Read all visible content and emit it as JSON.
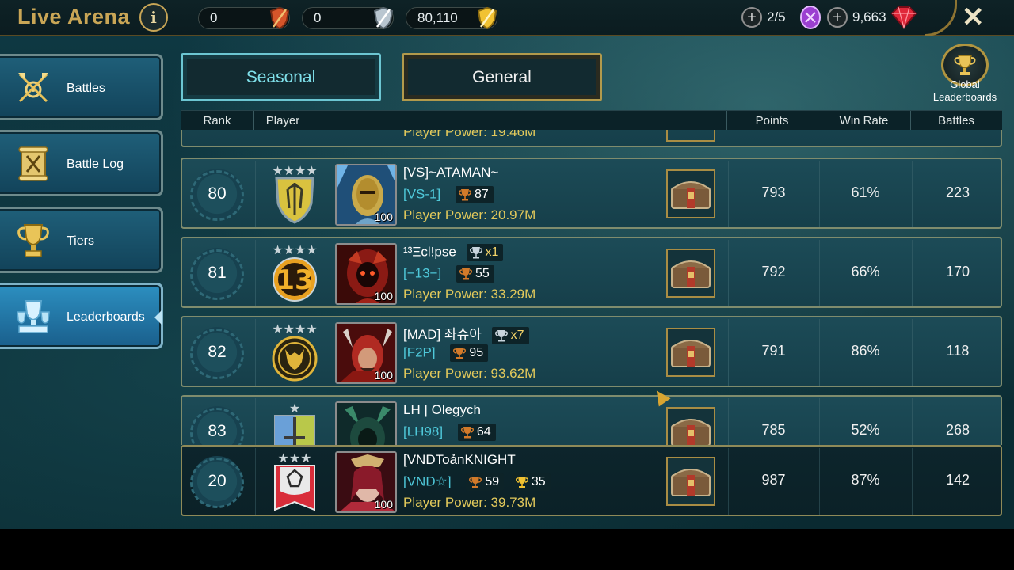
{
  "header": {
    "title": "Live Arena",
    "info_label": "i",
    "resources": [
      {
        "value": "0",
        "icon": "red-shield-icon"
      },
      {
        "value": "0",
        "icon": "silver-shield-icon"
      },
      {
        "value": "80,110",
        "icon": "gold-shield-icon"
      }
    ],
    "tokens": {
      "value": "2/5",
      "icon": "purple-token-icon"
    },
    "gems": {
      "value": "9,663",
      "icon": "ruby-gem-icon"
    },
    "plus": "+",
    "close": "✕"
  },
  "sidebar": {
    "items": [
      {
        "label": "Battles",
        "icon": "crossed-axes-icon",
        "active": false
      },
      {
        "label": "Battle Log",
        "icon": "scroll-icon",
        "active": false
      },
      {
        "label": "Tiers",
        "icon": "trophy-icon",
        "active": false
      },
      {
        "label": "Leaderboards",
        "icon": "leaderboard-trophies-icon",
        "active": true
      }
    ]
  },
  "tabs": {
    "seasonal": "Seasonal",
    "general": "General",
    "active": "general"
  },
  "global_leaderboards": {
    "line1": "Global",
    "line2": "Leaderboards"
  },
  "table": {
    "headers": {
      "rank": "Rank",
      "player": "Player",
      "points": "Points",
      "win_rate": "Win Rate",
      "battles": "Battles"
    },
    "partial_row_power": "Player Power: 19.46M",
    "rows": [
      {
        "rank": "80",
        "name": "[VS]~ATAMAN~",
        "clan": "[VS-1]",
        "trophies": "87",
        "champs": "",
        "level": "100",
        "power": "Player Power: 20.97M",
        "points": "793",
        "win_rate": "61%",
        "battles": "223"
      },
      {
        "rank": "81",
        "name": "¹³Ξcl!pse",
        "clan": "[−13−]",
        "trophies": "55",
        "champs": "x1",
        "level": "100",
        "power": "Player Power: 33.29M",
        "points": "792",
        "win_rate": "66%",
        "battles": "170"
      },
      {
        "rank": "82",
        "name": "[MAD] 좌슈아",
        "clan": "[F2P]",
        "trophies": "95",
        "champs": "x7",
        "level": "100",
        "power": "Player Power: 93.62M",
        "points": "791",
        "win_rate": "86%",
        "battles": "118"
      },
      {
        "rank": "83",
        "name": "LH | Olegych",
        "clan": "[LH98]",
        "trophies": "64",
        "champs": "",
        "level": "",
        "power": "",
        "points": "785",
        "win_rate": "52%",
        "battles": "268"
      }
    ],
    "me": {
      "rank": "20",
      "name": "[VNDToảnKNIGHT",
      "clan": "[VND☆]",
      "trophies": "59",
      "gold_trophies": "35",
      "level": "100",
      "power": "Player Power: 39.73M",
      "points": "987",
      "win_rate": "87%",
      "battles": "142"
    }
  }
}
